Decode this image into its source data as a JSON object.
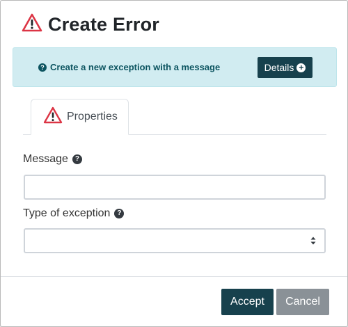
{
  "dialog": {
    "title": "Create Error",
    "title_icon": "warning-triangle-icon"
  },
  "info": {
    "icon": "question-circle-icon",
    "icon_glyph": "?",
    "text": "Create a new exception with a message",
    "details_label": "Details",
    "details_icon": "plus-circle-icon",
    "details_glyph": "+"
  },
  "tabs": [
    {
      "label": "Properties",
      "icon": "warning-triangle-icon",
      "active": true
    }
  ],
  "fields": {
    "message": {
      "label": "Message",
      "help_glyph": "?",
      "value": "",
      "placeholder": ""
    },
    "exception_type": {
      "label": "Type of exception",
      "help_glyph": "?",
      "selected": ""
    }
  },
  "footer": {
    "accept_label": "Accept",
    "cancel_label": "Cancel"
  },
  "colors": {
    "primary": "#17414d",
    "secondary": "#8a9197",
    "info_bg": "#d1ecf1",
    "info_text": "#0c5460",
    "warning": "#dc3545"
  }
}
